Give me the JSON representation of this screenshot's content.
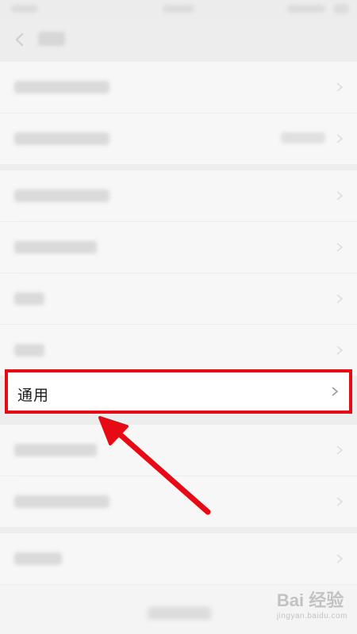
{
  "highlighted_item": {
    "label": "通用"
  },
  "watermark": {
    "brand": "Bai 经验",
    "url": "jingyan.baidu.com"
  },
  "colors": {
    "highlight": "#e50a14",
    "arrow": "#e50a14"
  },
  "icons": {
    "back": "chevron-left-icon",
    "row": "chevron-right-icon"
  }
}
